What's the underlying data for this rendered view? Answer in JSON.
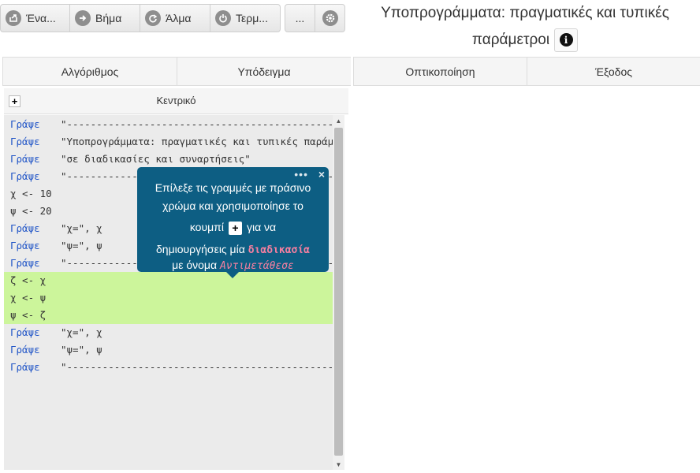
{
  "toolbar": {
    "buttons": [
      {
        "label": "Ένα...",
        "icon": "export-icon"
      },
      {
        "label": "Βήμα",
        "icon": "arrow-right-icon"
      },
      {
        "label": "Άλμα",
        "icon": "redo-icon"
      },
      {
        "label": "Τερμ...",
        "icon": "power-icon"
      }
    ],
    "more_label": "...",
    "settings_icon": "gear-icon"
  },
  "page_title": "Υποπρογράμματα: πραγματικές και τυπικές παράμετροι",
  "info_glyph": "i",
  "tabs": [
    "Αλγόριθμος",
    "Υπόδειγμα",
    "Οπτικοποίηση",
    "Έξοδος"
  ],
  "editor": {
    "add_glyph": "+",
    "title": "Κεντρικό",
    "lines": [
      {
        "kw": "Γράψε",
        "text": "\"-----------------------------------------------------",
        "hl": false
      },
      {
        "kw": "Γράψε",
        "text": "\"Υποπρογράμματα: πραγματικές και τυπικές παράμετροι\"",
        "hl": false
      },
      {
        "kw": "Γράψε",
        "text": "\"σε διαδικασίες και συναρτήσεις\"",
        "hl": false
      },
      {
        "kw": "Γράψε",
        "text": "\"-----------------------------------------------------",
        "hl": false
      },
      {
        "kw": "",
        "text": "χ <- 10",
        "hl": false
      },
      {
        "kw": "",
        "text": "ψ <- 20",
        "hl": false
      },
      {
        "kw": "Γράψε",
        "text": "\"χ=\", χ",
        "hl": false
      },
      {
        "kw": "Γράψε",
        "text": "\"ψ=\", ψ",
        "hl": false
      },
      {
        "kw": "Γράψε",
        "text": "\"-----------------------------------------------------",
        "hl": false
      },
      {
        "kw": "",
        "text": "ζ <- χ",
        "hl": true
      },
      {
        "kw": "",
        "text": "χ <- ψ",
        "hl": true
      },
      {
        "kw": "",
        "text": "ψ <- ζ",
        "hl": true
      },
      {
        "kw": "Γράψε",
        "text": "\"χ=\", χ",
        "hl": false
      },
      {
        "kw": "Γράψε",
        "text": "\"ψ=\", ψ",
        "hl": false
      },
      {
        "kw": "Γράψε",
        "text": "\"-----------------------------------------------------",
        "hl": false
      }
    ]
  },
  "tooltip": {
    "dots": "•••",
    "close": "×",
    "line1": "Επίλεξε τις γραμμές με πράσινο",
    "line2": "χρώμα και χρησιμοποίησε το",
    "line3_pre": "κουμπί",
    "button_glyph": "+",
    "line3_post": "για να",
    "line4_pre": "δημιουργήσεις μία",
    "emph1": "διαδικασία",
    "line5_pre": "με όνομα",
    "emph2": "Αντιμετάθεσε"
  },
  "colors": {
    "keyword": "#2155c7",
    "highlight": "#ccf59b",
    "tooltip_bg": "#0d5e83",
    "tooltip_emphasis": "#f57fa0"
  }
}
